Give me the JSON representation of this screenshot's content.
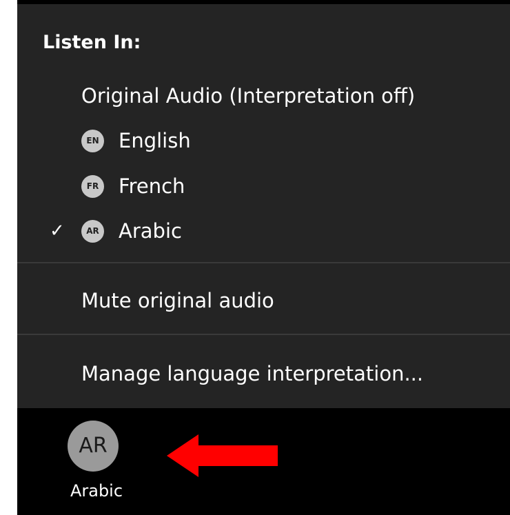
{
  "menu": {
    "heading": "Listen In:",
    "items": [
      {
        "label": "Original Audio (Interpretation off)",
        "badge": "",
        "checked": false
      },
      {
        "label": "English",
        "badge": "EN",
        "checked": false
      },
      {
        "label": "French",
        "badge": "FR",
        "checked": false
      },
      {
        "label": "Arabic",
        "badge": "AR",
        "checked": true
      }
    ],
    "check_mark": "✓",
    "mute_label": "Mute original audio",
    "manage_label": "Manage language interpretation..."
  },
  "toolbar": {
    "interpretation_badge": "AR",
    "interpretation_label": "Arabic"
  },
  "annotation": {
    "arrow_color": "#ff0000",
    "arrow_icon": "left-arrow-icon"
  }
}
